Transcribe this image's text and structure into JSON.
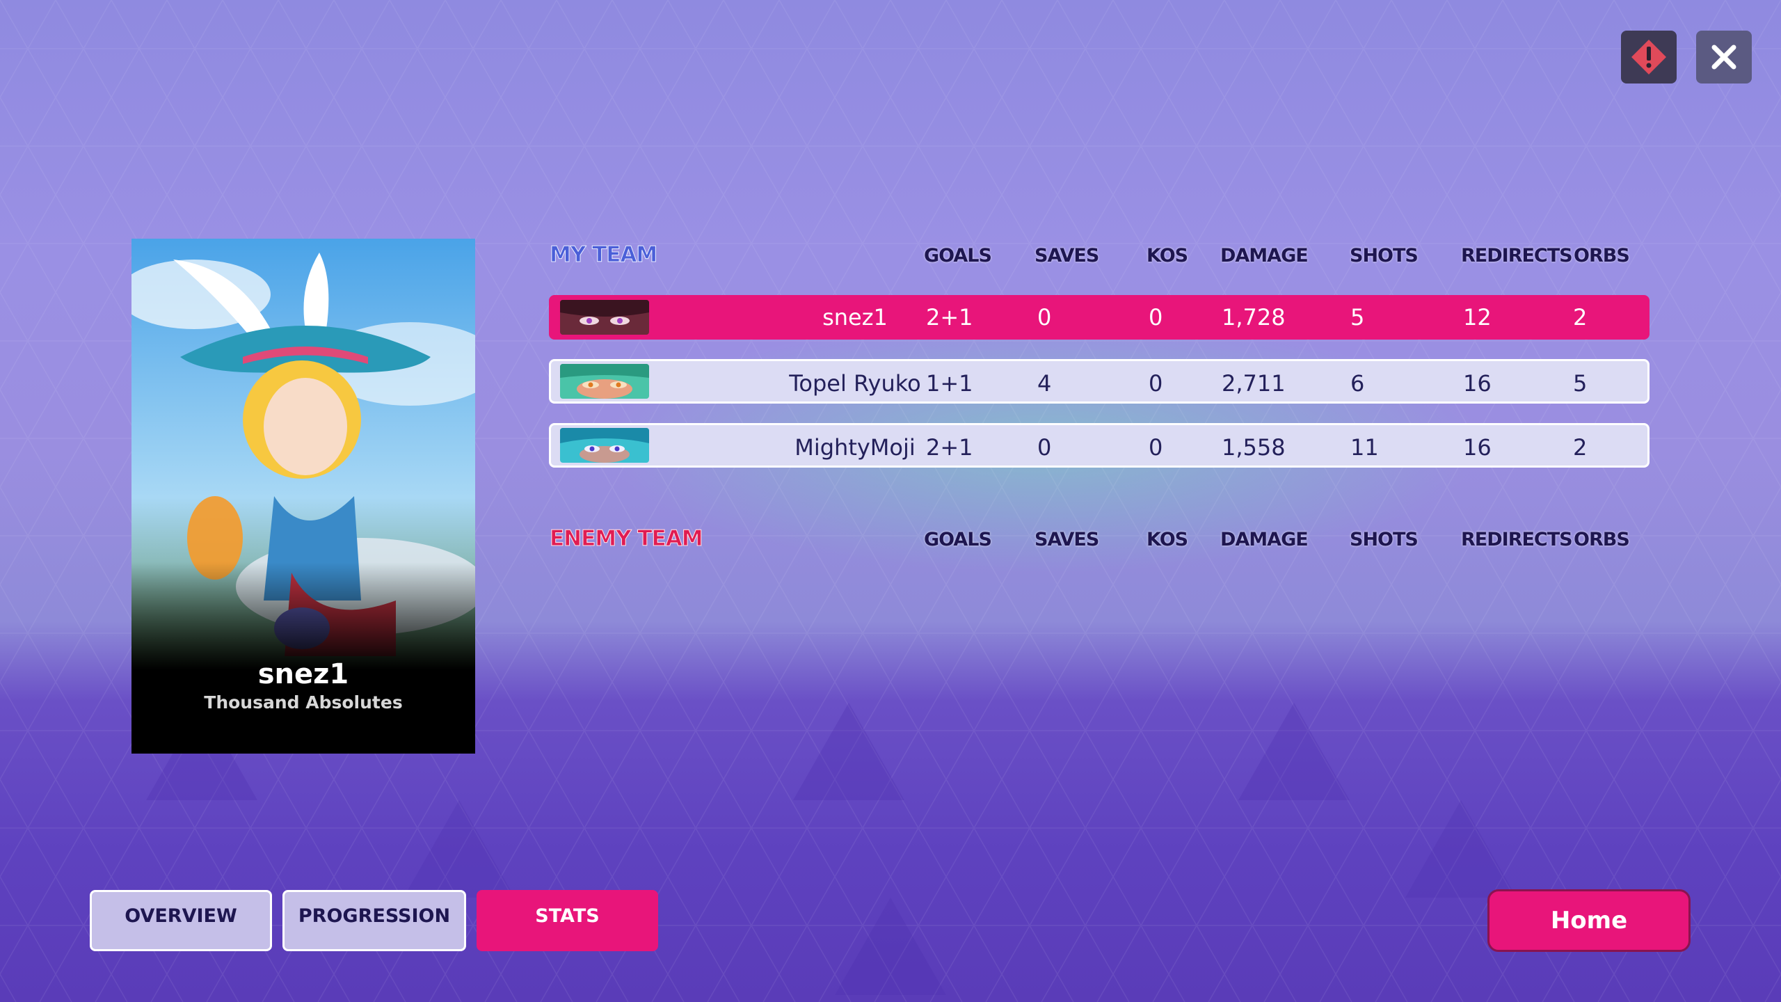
{
  "window": {
    "report_icon": "report-warning-icon",
    "close_icon": "close-icon"
  },
  "card": {
    "player_name": "snez1",
    "title": "Thousand Absolutes"
  },
  "my_team": {
    "label": "MY TEAM",
    "columns": [
      "GOALS",
      "SAVES",
      "KOS",
      "DAMAGE",
      "SHOTS",
      "REDIRECTS",
      "ORBS"
    ],
    "rows": [
      {
        "name": "snez1",
        "goals": "2+1",
        "saves": "0",
        "kos": "0",
        "damage": "1,728",
        "shots": "5",
        "redirects": "12",
        "orbs": "2",
        "highlight": true
      },
      {
        "name": "Topel Ryuko",
        "goals": "1+1",
        "saves": "4",
        "kos": "0",
        "damage": "2,711",
        "shots": "6",
        "redirects": "16",
        "orbs": "5",
        "highlight": false
      },
      {
        "name": "MightyMoji",
        "goals": "2+1",
        "saves": "0",
        "kos": "0",
        "damage": "1,558",
        "shots": "11",
        "redirects": "16",
        "orbs": "2",
        "highlight": false
      }
    ]
  },
  "enemy_team": {
    "label": "ENEMY TEAM",
    "columns": [
      "GOALS",
      "SAVES",
      "KOS",
      "DAMAGE",
      "SHOTS",
      "REDIRECTS",
      "ORBS"
    ],
    "rows": []
  },
  "tabs": [
    {
      "label": "OVERVIEW",
      "active": false
    },
    {
      "label": "PROGRESSION",
      "active": false
    },
    {
      "label": "STATS",
      "active": true
    }
  ],
  "home_button": "Home",
  "colors": {
    "accent_pink": "#e8157a",
    "my_team_blue": "#4a5fd8",
    "enemy_red": "#e01c52",
    "text_dark": "#1e1650"
  }
}
